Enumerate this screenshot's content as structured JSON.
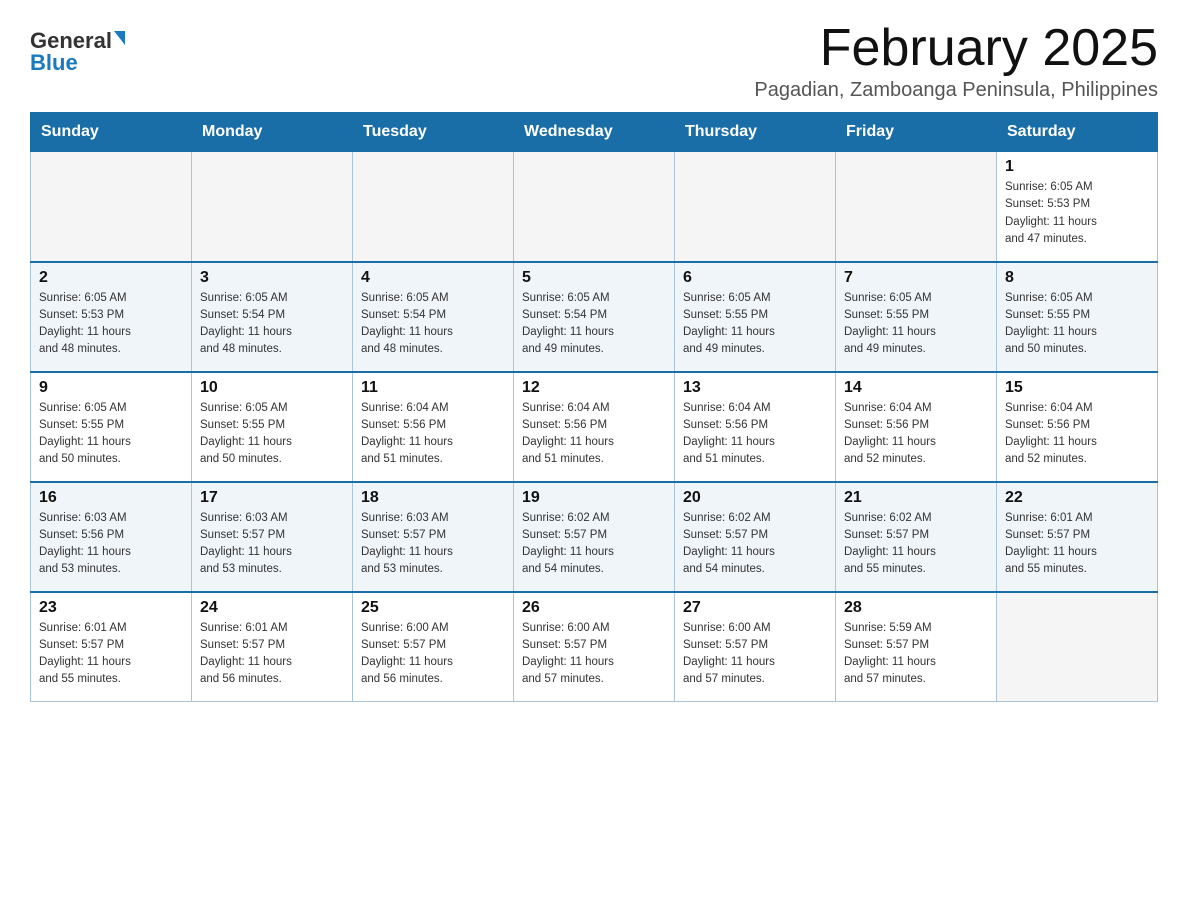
{
  "header": {
    "logo": {
      "general": "General",
      "blue": "Blue"
    },
    "title": "February 2025",
    "subtitle": "Pagadian, Zamboanga Peninsula, Philippines"
  },
  "days_of_week": [
    "Sunday",
    "Monday",
    "Tuesday",
    "Wednesday",
    "Thursday",
    "Friday",
    "Saturday"
  ],
  "weeks": [
    [
      {
        "day": "",
        "info": ""
      },
      {
        "day": "",
        "info": ""
      },
      {
        "day": "",
        "info": ""
      },
      {
        "day": "",
        "info": ""
      },
      {
        "day": "",
        "info": ""
      },
      {
        "day": "",
        "info": ""
      },
      {
        "day": "1",
        "info": "Sunrise: 6:05 AM\nSunset: 5:53 PM\nDaylight: 11 hours\nand 47 minutes."
      }
    ],
    [
      {
        "day": "2",
        "info": "Sunrise: 6:05 AM\nSunset: 5:53 PM\nDaylight: 11 hours\nand 48 minutes."
      },
      {
        "day": "3",
        "info": "Sunrise: 6:05 AM\nSunset: 5:54 PM\nDaylight: 11 hours\nand 48 minutes."
      },
      {
        "day": "4",
        "info": "Sunrise: 6:05 AM\nSunset: 5:54 PM\nDaylight: 11 hours\nand 48 minutes."
      },
      {
        "day": "5",
        "info": "Sunrise: 6:05 AM\nSunset: 5:54 PM\nDaylight: 11 hours\nand 49 minutes."
      },
      {
        "day": "6",
        "info": "Sunrise: 6:05 AM\nSunset: 5:55 PM\nDaylight: 11 hours\nand 49 minutes."
      },
      {
        "day": "7",
        "info": "Sunrise: 6:05 AM\nSunset: 5:55 PM\nDaylight: 11 hours\nand 49 minutes."
      },
      {
        "day": "8",
        "info": "Sunrise: 6:05 AM\nSunset: 5:55 PM\nDaylight: 11 hours\nand 50 minutes."
      }
    ],
    [
      {
        "day": "9",
        "info": "Sunrise: 6:05 AM\nSunset: 5:55 PM\nDaylight: 11 hours\nand 50 minutes."
      },
      {
        "day": "10",
        "info": "Sunrise: 6:05 AM\nSunset: 5:55 PM\nDaylight: 11 hours\nand 50 minutes."
      },
      {
        "day": "11",
        "info": "Sunrise: 6:04 AM\nSunset: 5:56 PM\nDaylight: 11 hours\nand 51 minutes."
      },
      {
        "day": "12",
        "info": "Sunrise: 6:04 AM\nSunset: 5:56 PM\nDaylight: 11 hours\nand 51 minutes."
      },
      {
        "day": "13",
        "info": "Sunrise: 6:04 AM\nSunset: 5:56 PM\nDaylight: 11 hours\nand 51 minutes."
      },
      {
        "day": "14",
        "info": "Sunrise: 6:04 AM\nSunset: 5:56 PM\nDaylight: 11 hours\nand 52 minutes."
      },
      {
        "day": "15",
        "info": "Sunrise: 6:04 AM\nSunset: 5:56 PM\nDaylight: 11 hours\nand 52 minutes."
      }
    ],
    [
      {
        "day": "16",
        "info": "Sunrise: 6:03 AM\nSunset: 5:56 PM\nDaylight: 11 hours\nand 53 minutes."
      },
      {
        "day": "17",
        "info": "Sunrise: 6:03 AM\nSunset: 5:57 PM\nDaylight: 11 hours\nand 53 minutes."
      },
      {
        "day": "18",
        "info": "Sunrise: 6:03 AM\nSunset: 5:57 PM\nDaylight: 11 hours\nand 53 minutes."
      },
      {
        "day": "19",
        "info": "Sunrise: 6:02 AM\nSunset: 5:57 PM\nDaylight: 11 hours\nand 54 minutes."
      },
      {
        "day": "20",
        "info": "Sunrise: 6:02 AM\nSunset: 5:57 PM\nDaylight: 11 hours\nand 54 minutes."
      },
      {
        "day": "21",
        "info": "Sunrise: 6:02 AM\nSunset: 5:57 PM\nDaylight: 11 hours\nand 55 minutes."
      },
      {
        "day": "22",
        "info": "Sunrise: 6:01 AM\nSunset: 5:57 PM\nDaylight: 11 hours\nand 55 minutes."
      }
    ],
    [
      {
        "day": "23",
        "info": "Sunrise: 6:01 AM\nSunset: 5:57 PM\nDaylight: 11 hours\nand 55 minutes."
      },
      {
        "day": "24",
        "info": "Sunrise: 6:01 AM\nSunset: 5:57 PM\nDaylight: 11 hours\nand 56 minutes."
      },
      {
        "day": "25",
        "info": "Sunrise: 6:00 AM\nSunset: 5:57 PM\nDaylight: 11 hours\nand 56 minutes."
      },
      {
        "day": "26",
        "info": "Sunrise: 6:00 AM\nSunset: 5:57 PM\nDaylight: 11 hours\nand 57 minutes."
      },
      {
        "day": "27",
        "info": "Sunrise: 6:00 AM\nSunset: 5:57 PM\nDaylight: 11 hours\nand 57 minutes."
      },
      {
        "day": "28",
        "info": "Sunrise: 5:59 AM\nSunset: 5:57 PM\nDaylight: 11 hours\nand 57 minutes."
      },
      {
        "day": "",
        "info": ""
      }
    ]
  ]
}
